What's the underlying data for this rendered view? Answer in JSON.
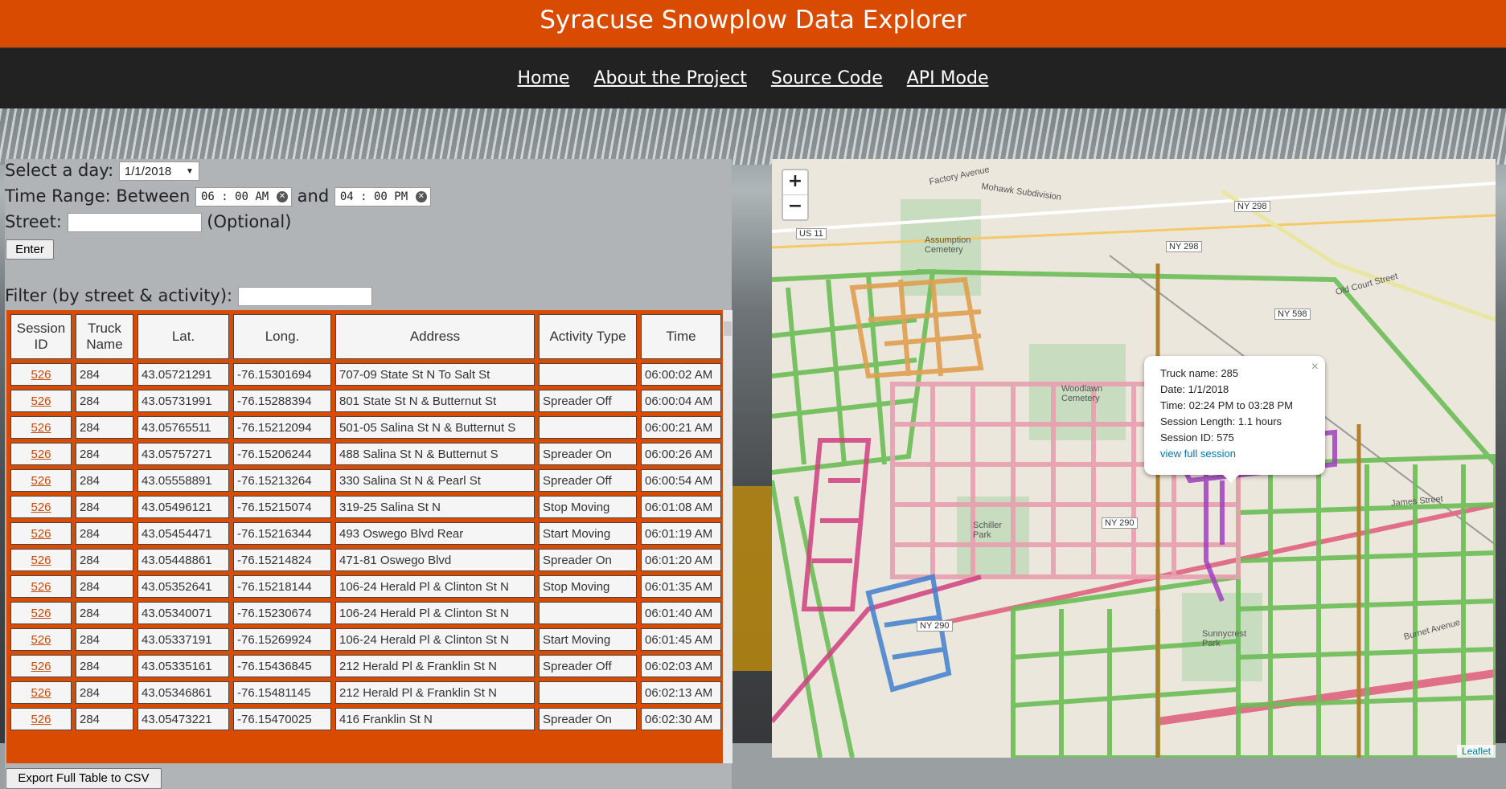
{
  "header": {
    "title": "Syracuse Snowplow Data Explorer"
  },
  "nav": {
    "items": [
      "Home",
      "About the Project",
      "Source Code",
      "API Mode"
    ]
  },
  "form": {
    "day_label": "Select a day:",
    "day_value": "1/1/2018",
    "time_label": "Time Range: Between",
    "time_start": "06 : 00   AM",
    "and_label": "and",
    "time_end": "04 : 00   PM",
    "street_label": "Street:",
    "street_value": "",
    "optional_label": "(Optional)",
    "enter_label": "Enter",
    "filter_label": "Filter (by street & activity):",
    "filter_value": "",
    "export_label": "Export Full Table to CSV"
  },
  "table": {
    "headers": [
      "Session ID",
      "Truck Name",
      "Lat.",
      "Long.",
      "Address",
      "Activity Type",
      "Time"
    ],
    "rows": [
      [
        "526",
        "284",
        "43.05721291",
        "-76.15301694",
        "707-09 State St N To Salt St",
        "",
        "06:00:02 AM"
      ],
      [
        "526",
        "284",
        "43.05731991",
        "-76.15288394",
        "801 State St N & Butternut St",
        "Spreader Off",
        "06:00:04 AM"
      ],
      [
        "526",
        "284",
        "43.05765511",
        "-76.15212094",
        "501-05 Salina St N & Butternut S",
        "",
        "06:00:21 AM"
      ],
      [
        "526",
        "284",
        "43.05757271",
        "-76.15206244",
        "488 Salina St N & Butternut S",
        "Spreader On",
        "06:00:26 AM"
      ],
      [
        "526",
        "284",
        "43.05558891",
        "-76.15213264",
        "330 Salina St N & Pearl St",
        "Spreader Off",
        "06:00:54 AM"
      ],
      [
        "526",
        "284",
        "43.05496121",
        "-76.15215074",
        "319-25 Salina St N",
        "Stop Moving",
        "06:01:08 AM"
      ],
      [
        "526",
        "284",
        "43.05454471",
        "-76.15216344",
        "493 Oswego Blvd Rear",
        "Start Moving",
        "06:01:19 AM"
      ],
      [
        "526",
        "284",
        "43.05448861",
        "-76.15214824",
        "471-81 Oswego Blvd",
        "Spreader On",
        "06:01:20 AM"
      ],
      [
        "526",
        "284",
        "43.05352641",
        "-76.15218144",
        "106-24 Herald Pl & Clinton St N",
        "Stop Moving",
        "06:01:35 AM"
      ],
      [
        "526",
        "284",
        "43.05340071",
        "-76.15230674",
        "106-24 Herald Pl & Clinton St N",
        "",
        "06:01:40 AM"
      ],
      [
        "526",
        "284",
        "43.05337191",
        "-76.15269924",
        "106-24 Herald Pl & Clinton St N",
        "Start Moving",
        "06:01:45 AM"
      ],
      [
        "526",
        "284",
        "43.05335161",
        "-76.15436845",
        "212 Herald Pl & Franklin St N",
        "Spreader Off",
        "06:02:03 AM"
      ],
      [
        "526",
        "284",
        "43.05346861",
        "-76.15481145",
        "212 Herald Pl & Franklin St N",
        "",
        "06:02:13 AM"
      ],
      [
        "526",
        "284",
        "43.05473221",
        "-76.15470025",
        "416 Franklin St N",
        "Spreader On",
        "06:02:30 AM"
      ]
    ]
  },
  "map": {
    "zoom_in": "+",
    "zoom_out": "−",
    "attribution": "Leaflet",
    "popup": {
      "close": "×",
      "truck": "Truck name: 285",
      "date": "Date: 1/1/2018",
      "time": "Time: 02:24 PM to 03:28 PM",
      "length": "Session Length: 1.1 hours",
      "session": "Session ID: 575",
      "link": "view full session"
    },
    "labels": {
      "factory": "Factory Avenue",
      "mohawk": "Mohawk Subdivision",
      "assumption": "Assumption Cemetery",
      "woodlawn": "Woodlawn Cemetery",
      "schiller": "Schiller Park",
      "sunnycrest": "Sunnycrest Park",
      "oldcourt": "Old Court Street",
      "burnet": "Burnet Avenue",
      "james": "James Street"
    },
    "shields": [
      "US 11",
      "NY 298",
      "NY 298",
      "NY 290",
      "NY 290",
      "NY 598"
    ]
  }
}
